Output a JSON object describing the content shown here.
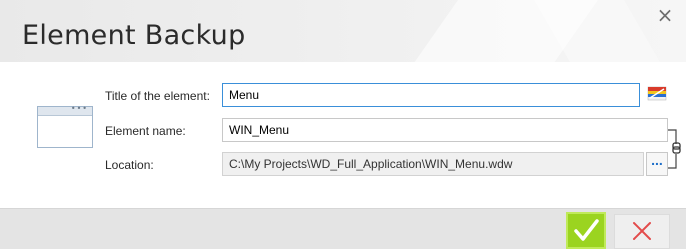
{
  "window": {
    "title": "Element Backup",
    "close_glyph": "×"
  },
  "form": {
    "title_label": "Title of the element:",
    "title_value": "Menu",
    "name_label": "Element name:",
    "name_value": "WIN_Menu",
    "location_label": "Location:",
    "location_value": "C:\\My Projects\\WD_Full_Application\\WIN_Menu.wdw",
    "browse_label": "..."
  },
  "icons": {
    "preview": "window-preview-icon",
    "translate": "language-flag-icon",
    "link": "chain-link-icon",
    "ok": "checkmark-icon",
    "cancel": "cross-icon"
  },
  "colors": {
    "accent_green": "#9bd420",
    "cancel_red": "#e34b4b",
    "focus_blue": "#3a8fd9"
  }
}
